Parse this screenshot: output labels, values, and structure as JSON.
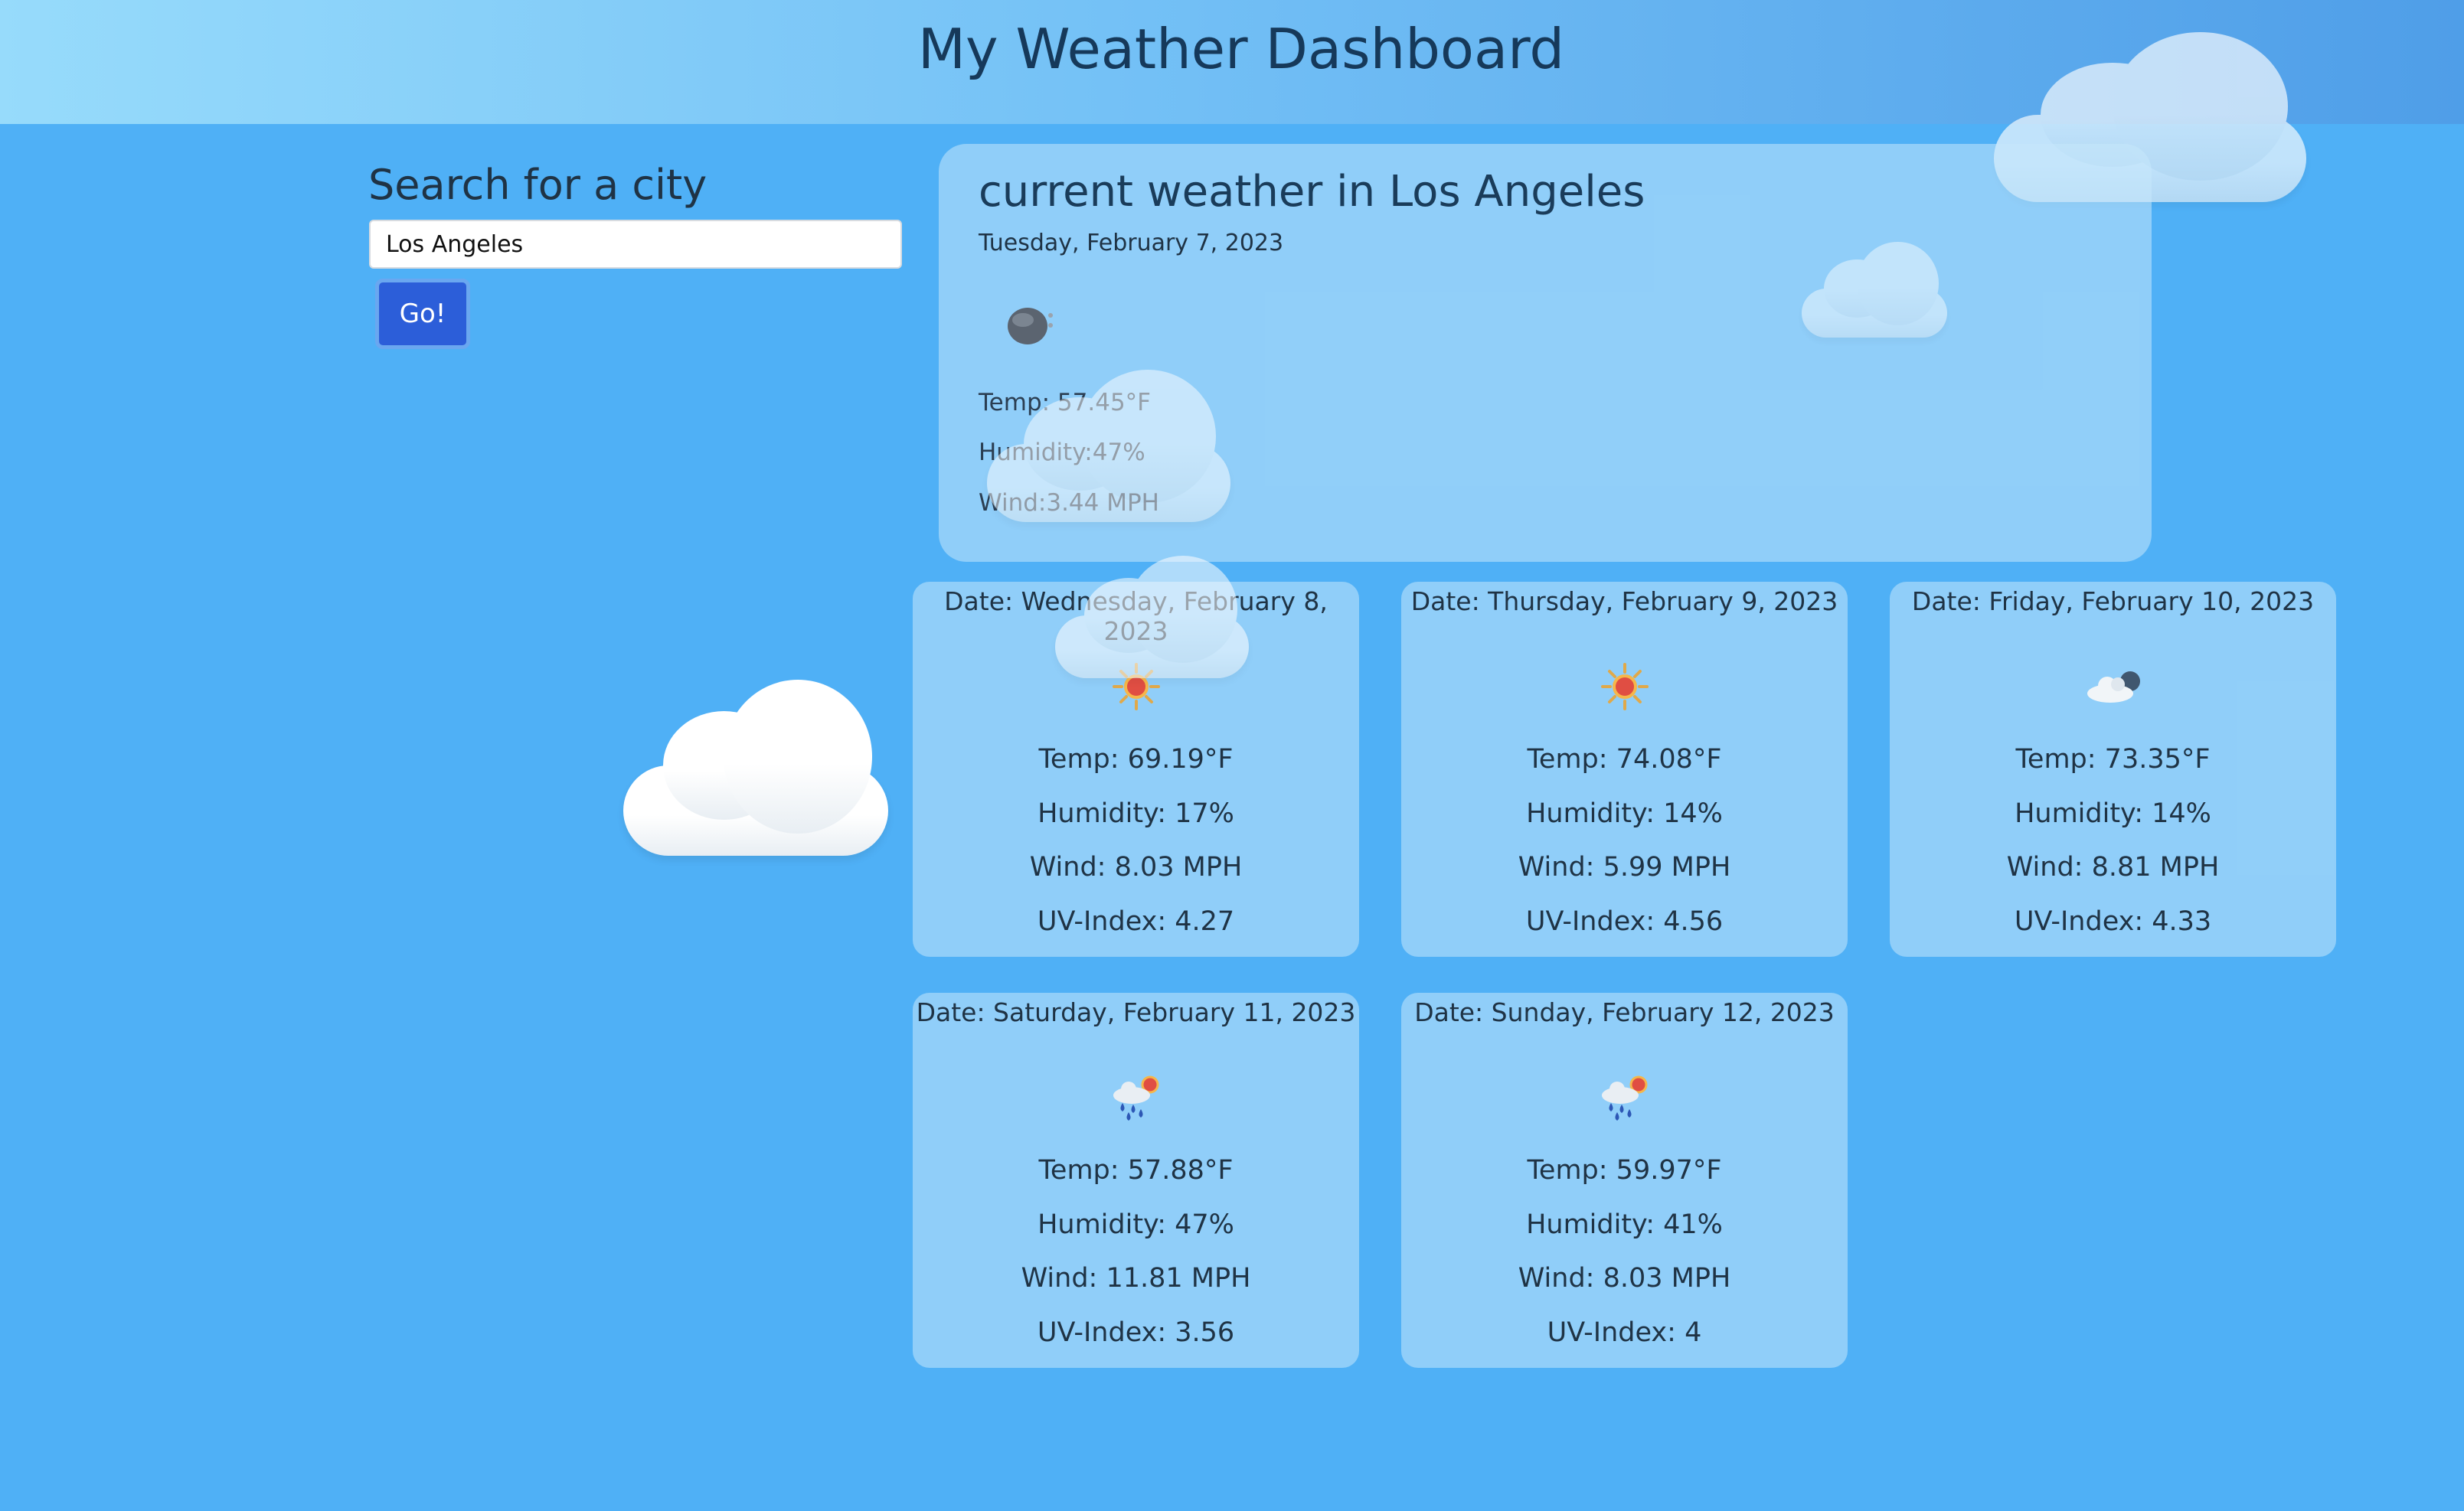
{
  "header": {
    "title": "My Weather Dashboard"
  },
  "search": {
    "title": "Search for a city",
    "input_value": "Los Angeles",
    "button_label": "Go!"
  },
  "current": {
    "title": "current weather in Los Angeles",
    "date": "Tuesday, February 7, 2023",
    "icon": "moon-icon",
    "temp": "Temp: 57.45°F",
    "humidity": "Humidity:47%",
    "wind": "Wind:3.44 MPH"
  },
  "forecast": [
    {
      "date": "Date: Wednesday, February 8, 2023",
      "icon": "sun-icon",
      "temp": "Temp: 69.19°F",
      "humidity": "Humidity: 17%",
      "wind": "Wind: 8.03 MPH",
      "uv": "UV-Index: 4.27"
    },
    {
      "date": "Date: Thursday, February 9, 2023",
      "icon": "sun-icon",
      "temp": "Temp: 74.08°F",
      "humidity": "Humidity: 14%",
      "wind": "Wind: 5.99 MPH",
      "uv": "UV-Index: 4.56"
    },
    {
      "date": "Date: Friday, February 10, 2023",
      "icon": "cloudy-night-icon",
      "temp": "Temp: 73.35°F",
      "humidity": "Humidity: 14%",
      "wind": "Wind: 8.81 MPH",
      "uv": "UV-Index: 4.33"
    },
    {
      "date": "Date: Saturday, February 11, 2023",
      "icon": "rain-sun-icon",
      "temp": "Temp: 57.88°F",
      "humidity": "Humidity: 47%",
      "wind": "Wind: 11.81 MPH",
      "uv": "UV-Index: 3.56"
    },
    {
      "date": "Date: Sunday, February 12, 2023",
      "icon": "rain-sun-icon",
      "temp": "Temp: 59.97°F",
      "humidity": "Humidity: 41%",
      "wind": "Wind: 8.03 MPH",
      "uv": "UV-Index: 4"
    }
  ],
  "colors": {
    "background": "#4fb0f6",
    "header_start": "#97dbfb",
    "header_end": "#4f9ee8",
    "button": "#2c5ed9",
    "card": "#c7e8fb"
  }
}
